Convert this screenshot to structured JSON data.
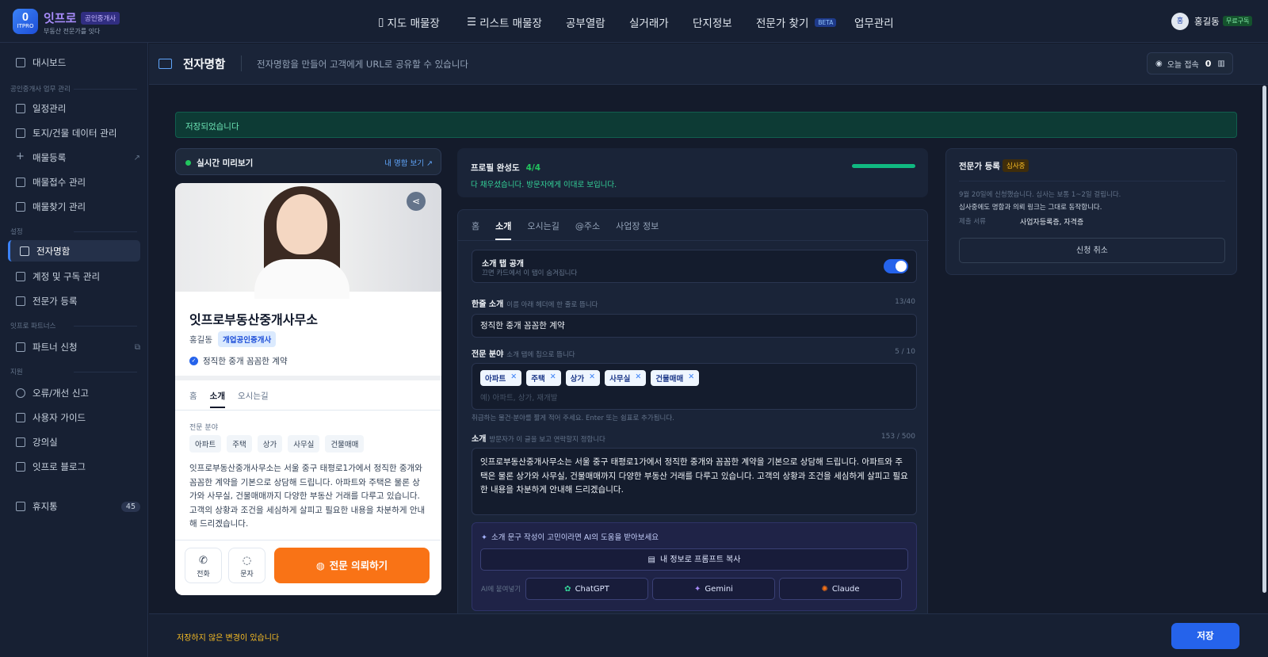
{
  "brand": {
    "name": "잇프로",
    "badge": "공인중개사",
    "tagline": "부동산 전문가를 잇다",
    "logo_text": "ITPRO"
  },
  "nav": [
    "지도 매물장",
    "리스트 매물장",
    "공부열람",
    "실거래가",
    "단지정보",
    "전문가 찾기",
    "업무관리"
  ],
  "nav_beta": "BETA",
  "user": {
    "initial": "홍",
    "name": "홍길동",
    "plan": "무료구독"
  },
  "sidebar": {
    "dashboard": "대시보드",
    "sec1": "공인중개사 업무 관리",
    "items1": [
      "일정관리",
      "토지/건물 데이터 관리",
      "매물등록",
      "매물접수 관리",
      "매물찾기 관리"
    ],
    "sec2": "설정",
    "items2": [
      "전자명함",
      "계정 및 구독 관리",
      "전문가 등록"
    ],
    "sec3": "잇프로 파트너스",
    "items3": [
      "파트너 신청"
    ],
    "sec4": "지원",
    "items4": [
      "오류/개선 신고",
      "사용자 가이드",
      "강의실",
      "잇프로 블로그"
    ],
    "trash": "휴지통",
    "trash_count": "45"
  },
  "header": {
    "title": "전자명함",
    "desc": "전자명함을 만들어 고객에게 URL로 공유할 수 있습니다",
    "visit_label": "오늘 접속",
    "visit_count": "0"
  },
  "saved_msg": "저장되었습니다",
  "preview": {
    "title": "실시간 미리보기",
    "link": "내 명함 보기 ↗"
  },
  "card": {
    "name": "잇프로부동산중개사무소",
    "person": "홍길동",
    "badge": "개업공인중개사",
    "tagline": "정직한 중개 꼼꼼한 계약",
    "tabs": [
      "홈",
      "소개",
      "오시는길"
    ],
    "field_label": "전문 분야",
    "tags": [
      "아파트",
      "주택",
      "상가",
      "사무실",
      "건물매매"
    ],
    "desc": "잇프로부동산중개사무소는 서울 중구 태평로1가에서 정직한 중개와 꼼꼼한 계약을 기본으로 상담해 드립니다. 아파트와 주택은 물론 상가와 사무실, 건물매매까지 다양한 부동산 거래를 다루고 있습니다. 고객의 상황과 조건을 세심하게 살피고 필요한 내용을 차분하게 안내해 드리겠습니다.",
    "call": "전화",
    "sms": "문자",
    "cta": "전문 의뢰하기"
  },
  "profile": {
    "label": "프로필 완성도",
    "count": "4/4",
    "progress": 1.0,
    "msg": "다 채우셨습니다. 방문자에게 이대로 보입니다."
  },
  "editor": {
    "tabs": [
      "홈",
      "소개",
      "오시는길",
      "@주소",
      "사업장 정보"
    ],
    "toggle_title": "소개 탭 공개",
    "toggle_sub": "끄면 카드에서 이 탭이 숨겨집니다",
    "toggle_on": true,
    "oneline_label": "한줄 소개",
    "oneline_hint": "이름 아래 헤더에 한 줄로 뜹니다",
    "oneline_count": "13/40",
    "oneline_value": "정직한 중개 꼼꼼한 계약",
    "field_label": "전문 분야",
    "field_hint": "소개 탭에 칩으로 뜹니다",
    "field_count": "5 / 10",
    "chips": [
      "아파트",
      "주택",
      "상가",
      "사무실",
      "건물매매"
    ],
    "field_placeholder": "예) 아파트, 상가, 재개발",
    "field_help": "취급하는 물건·분야를 짧게 적어 주세요. Enter 또는 쉼표로 추가됩니다.",
    "intro_label": "소개",
    "intro_hint": "방문자가 이 글을 보고 연락할지 정합니다",
    "intro_count": "153 / 500",
    "intro_value": "잇프로부동산중개사무소는 서울 중구 태평로1가에서 정직한 중개와 꼼꼼한 계약을 기본으로 상담해 드립니다. 아파트와 주택은 물론 상가와 사무실, 건물매매까지 다양한 부동산 거래를 다루고 있습니다. 고객의 상황과 조건을 세심하게 살피고 필요한 내용을 차분하게 안내해 드리겠습니다.",
    "ai_tip": "소개 문구 작성이 고민이라면 AI의 도움을 받아보세요",
    "ai_copy": "내 정보로 프롬프트 복사",
    "ai_paste": "AI에 붙여넣기",
    "ai_tools": [
      "ChatGPT",
      "Gemini",
      "Claude"
    ]
  },
  "expert": {
    "title": "전문가 등록",
    "badge": "심사중",
    "s1": "9월 20일에 신청했습니다. 심사는 보통 1~2일 걸립니다.",
    "s2": "심사중에도 명함과 의뢰 링크는 그대로 동작합니다.",
    "doc_label": "제출 서류",
    "doc_value": "사업자등록증, 자격증",
    "cancel": "신청 취소"
  },
  "footer": {
    "warn": "저장하지 않은 변경이 있습니다",
    "save": "저장"
  }
}
